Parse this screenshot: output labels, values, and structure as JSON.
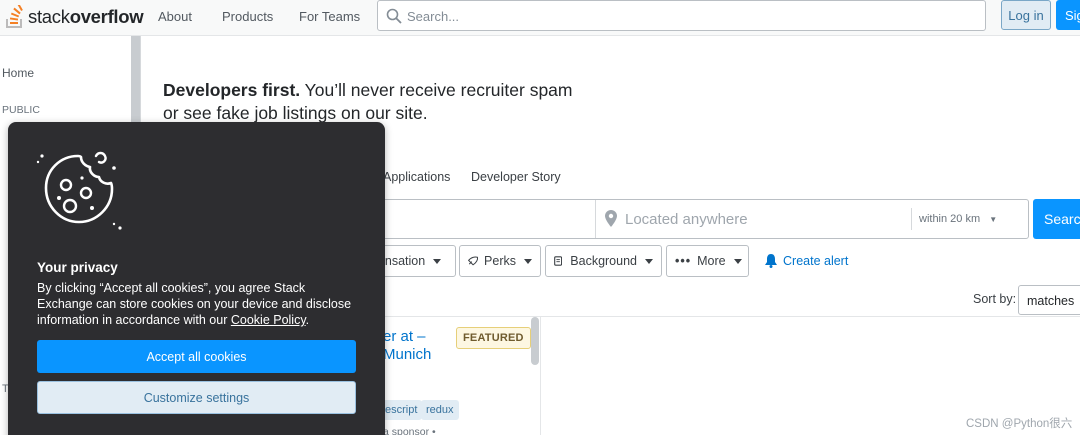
{
  "header": {
    "logo": {
      "text_light": "stack",
      "text_bold": "overflow"
    },
    "nav": [
      "About",
      "Products",
      "For Teams"
    ],
    "search_placeholder": "Search...",
    "login_label": "Log in",
    "signup_label": "Sig"
  },
  "sidebar": {
    "home": "Home",
    "public": "PUBLIC",
    "partial_letter": "T"
  },
  "main": {
    "headline_bold": "Developers first.",
    "headline_rest": " You’ll never receive recruiter spam or see fake job listings on our site.",
    "tabs": [
      "Applications",
      "Developer Story"
    ],
    "location_placeholder": "Located anywhere",
    "radius": "within 20 km",
    "search_button": "Searc",
    "filters": [
      "pensation",
      "Perks",
      "Background",
      "More"
    ],
    "create_alert": "Create alert",
    "sort_label": "Sort by:",
    "sort_value": "matches",
    "job": {
      "title": "er at – Munich",
      "featured": "FEATURED",
      "tags": [
        "escript",
        "redux"
      ],
      "sponsor": "a sponsor •"
    },
    "watermark": "CSDN @Python很六"
  },
  "cookie": {
    "title": "Your privacy",
    "body_text": "By clicking “Accept all cookies”, you agree Stack Exchange can store cookies on your device and disclose information in accordance with our ",
    "link": "Cookie Policy",
    "body_end": ".",
    "accept": "Accept all cookies",
    "customize": "Customize settings"
  },
  "colors": {
    "accent": "#0a95ff",
    "brand_orange": "#f48024",
    "modal_bg": "#2d2d30",
    "link": "#0074cc"
  }
}
